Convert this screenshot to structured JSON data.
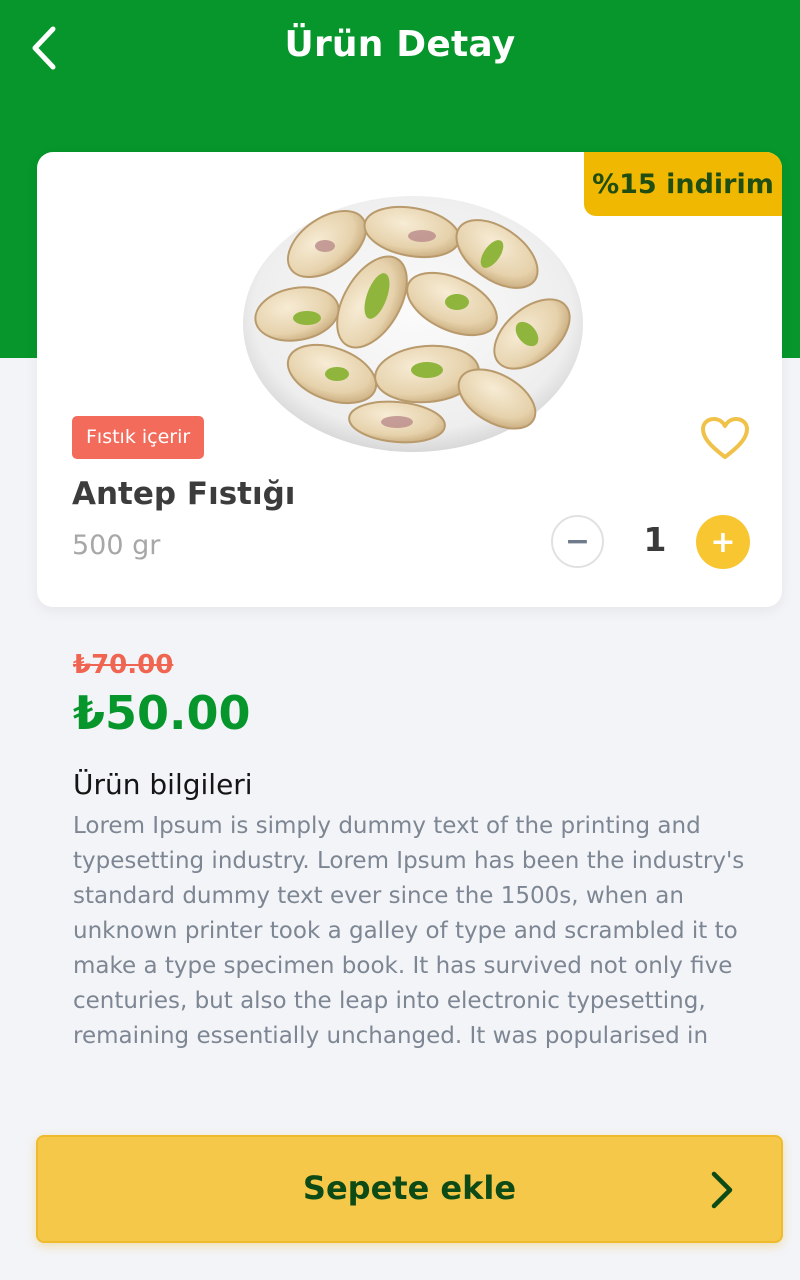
{
  "header": {
    "title": "Ürün Detay",
    "back_icon": "chevron-left-icon"
  },
  "product": {
    "discount_badge": "%15 indirim",
    "allergen_tag": "Fıstık içerir",
    "name": "Antep Fıstığı",
    "weight": "500 gr",
    "favorite_icon": "heart-outline-icon",
    "quantity": {
      "decrement_label": "−",
      "value": "1",
      "increment_label": "+"
    }
  },
  "pricing": {
    "old_price": "₺70.00",
    "new_price": "₺50.00"
  },
  "info": {
    "title": "Ürün bilgileri",
    "body": "Lorem Ipsum is simply dummy text of the printing and typesetting industry. Lorem Ipsum has been the industry's standard dummy text ever since the 1500s, when an unknown printer took a galley of type and scrambled it to make a type specimen book. It has survived not only five centuries, but also the leap into electronic typesetting, remaining essentially unchanged. It was popularised in"
  },
  "cart": {
    "label": "Sepete ekle",
    "arrow_icon": "chevron-right-icon"
  },
  "colors": {
    "brand_green": "#06962b",
    "accent_yellow": "#f7c631",
    "discount_yellow": "#f0b800",
    "tag_red": "#f26b5b",
    "old_price_red": "#ef6551"
  }
}
